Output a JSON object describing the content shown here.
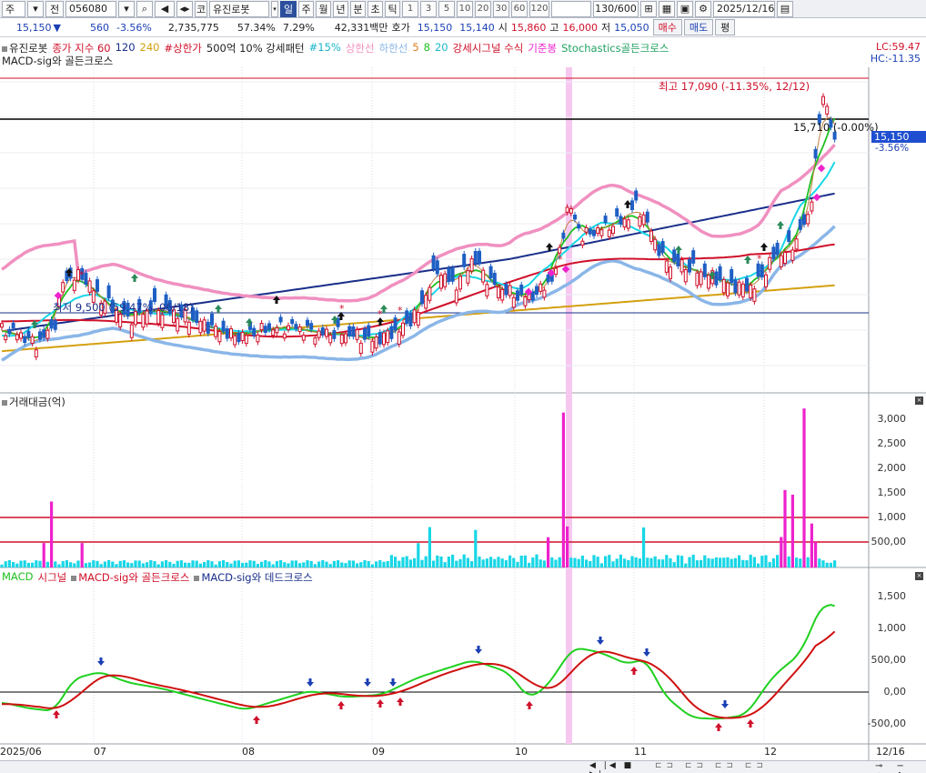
{
  "toolbar": {
    "market_select": "주",
    "code_prefix": "전",
    "code": "056080",
    "menu_glyph": "▾",
    "search": "⌕",
    "sound": "◀",
    "arrows": "◂▸",
    "name_prefix": "코",
    "stock_name": "유진로봇",
    "periods": [
      "일",
      "주",
      "월",
      "년",
      "분",
      "초",
      "틱"
    ],
    "interval_buttons": [
      "1",
      "3",
      "5",
      "10",
      "20",
      "30",
      "60",
      "120"
    ],
    "count": "130/600",
    "date": "2025/12/16"
  },
  "quote": {
    "price": "15,150",
    "arrow": "▼",
    "change": "560",
    "change_pct": "-3.56%",
    "volume": "2,735,775",
    "turnover_pct": "57.34%",
    "rate2": "7.29%",
    "amount": "42,331백만",
    "ask_label": "호가",
    "ask1": "15,150",
    "ask2": "15,140",
    "open_label": "시",
    "open": "15,860",
    "high_label": "고",
    "high": "16,000",
    "low_label": "저",
    "low": "15,050",
    "buy": "매수",
    "sell": "매도",
    "balance": "평"
  },
  "price_panel": {
    "legend": [
      "유진로봇",
      "종가 지수 60",
      "120",
      "240",
      "#상한가",
      "500억 10% 강세패턴",
      "#15%",
      "상한선",
      "하한선",
      "5",
      "8",
      "20",
      "강세시그널 수식",
      "기준봉",
      "Stochastics골든크로스"
    ],
    "legend2": "MACD-sig와 골든크로스",
    "lc": "LC:59.47",
    "hc": "HC:-11.35",
    "high_note": "최고 17,090 (-11.35%, 12/12)",
    "low_note": "최저 9,500 (59.47%, 06/18)",
    "ref_note": "15,710 (-0.00%)",
    "last_price": "15,150",
    "last_pct": "-3.56%"
  },
  "volume_panel": {
    "title": "거래대금(억)",
    "ticks": [
      "3,000",
      "2,500",
      "2,000",
      "1,500",
      "1,000",
      "500,00"
    ]
  },
  "macd_panel": {
    "legend": [
      "MACD",
      "시그널",
      "MACD-sig와 골든크로스",
      "MACD-sig와 데드크로스"
    ],
    "ticks": [
      "1,500",
      "1,000",
      "500,00",
      "0,00",
      "-500,00"
    ]
  },
  "xaxis": {
    "labels": [
      "2025/06",
      "07",
      "08",
      "09",
      "10",
      "11",
      "12"
    ],
    "end_label": "12/16"
  },
  "colors": {
    "up": "#d0102a",
    "down": "#1f5fc4",
    "ma5": "#e05050",
    "ma20": "#20c020",
    "ma60": "#1a2f8a",
    "ma120": "#d4a010",
    "cyan": "#18d6e6",
    "pink": "#f090c0",
    "lightblue": "#8ab6e8",
    "magenta": "#ee22cc",
    "highlight": "#f6c8f0"
  },
  "chart_data": {
    "type": "line",
    "categories": [
      "2025/06",
      "07",
      "08",
      "09",
      "10",
      "11",
      "12"
    ],
    "series": [
      {
        "name": "유진로봇",
        "values": [
          10200,
          11600,
          10300,
          10200,
          12800,
          13100,
          16200
        ]
      },
      {
        "name": "120",
        "values": [
          10300,
          10700,
          11000,
          11200,
          11700,
          12600,
          13500
        ]
      }
    ],
    "annotations": [
      "최고 17,090 (-11.35%, 12/12)",
      "최저 9,500 (59.47%, 06/18)"
    ]
  }
}
